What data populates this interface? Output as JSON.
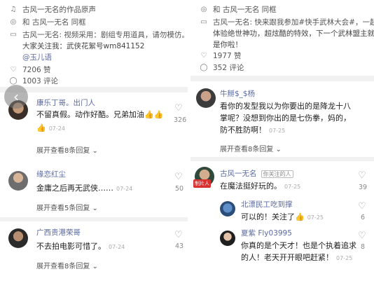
{
  "left": {
    "video_source": "古风一无名的作品原声",
    "same_frame": "和 古风一无名 同框",
    "desc_line1": "古风一无名: 视频采用：剧组专用道具，请勿模仿。",
    "desc_line2": "大家关注我：武侠花絮号wm841152",
    "mention": "@玉儿语",
    "likes": "7206 赞",
    "comments": "1003 评论",
    "comments_list": [
      {
        "name": "康乐丁哥。出门人",
        "text1": "不留真假。动作好酷。兄弟加油",
        "text2": "",
        "time": "07-24",
        "likes": "326",
        "expand": "展开查看8条回复"
      },
      {
        "name": "缘恋红尘",
        "text1": "金庸之后再无武侠……",
        "time": "07-24",
        "likes": "50",
        "expand": "展开查看5条回复"
      },
      {
        "name": "广西贵港荣哥",
        "text1": "不去拍电影可惜了。",
        "time": "07-24",
        "likes": "43",
        "expand": "展开查看8条回复"
      }
    ]
  },
  "right": {
    "same_frame": "和 古风一无名 同框",
    "desc_line1": "古风一无名: 快来跟我参加#快手武林大会#，一起",
    "desc_line2": "体验绝世神功，超炫酷的特效，下一个武林盟主就",
    "desc_line3": "是你啦！",
    "likes": "1977 赞",
    "comments": "352 评论",
    "comment1": {
      "name": "牛掰$_$杨",
      "text1": "看你的发型我以为你要出的是降龙十八",
      "text2": "掌呢？没想到你出的是七伤拳，妈的，",
      "text3": "防不胜防啊！",
      "time": "07-25",
      "expand": "展开查看8条回复"
    },
    "comment2": {
      "name": "古风一无名",
      "tag": "你关注的人",
      "badge": "制片人",
      "text1": "在魔法挺好玩的。",
      "time": "07-25",
      "likes": "39"
    },
    "reply1": {
      "name": "北漂民工吃到撑",
      "text1": "可以的！关注了",
      "time": "07-25",
      "likes": "6"
    },
    "reply2": {
      "name": "夏紫  Fly03995",
      "text1": "你真的是个天才！也是个执着追求",
      "text2": "的人！老天开开眼吧赶紧！",
      "time": "07-25",
      "likes": "8"
    }
  }
}
